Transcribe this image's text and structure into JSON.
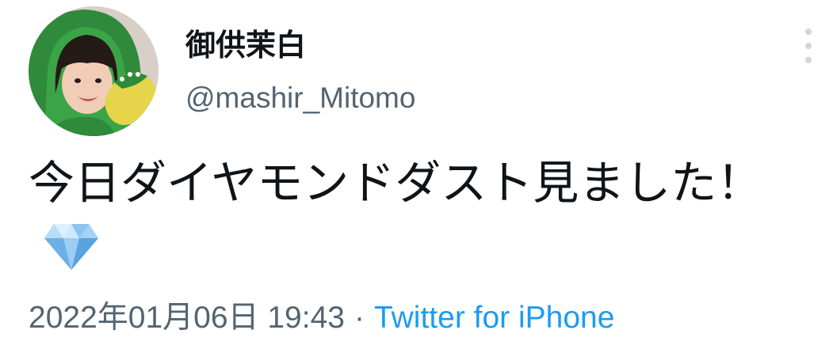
{
  "tweet": {
    "display_name": "御供茉白",
    "handle": "@mashir_Mitomo",
    "text": "今日ダイヤモンドダスト見ました！",
    "emoji_icon": "gem-icon",
    "timestamp": "2022年01月06日 19:43",
    "separator": "·",
    "source": "Twitter for iPhone"
  },
  "colors": {
    "text": "#0f1419",
    "secondary": "#536471",
    "link": "#1d9bf0",
    "more_dots": "#cfd6dc"
  }
}
